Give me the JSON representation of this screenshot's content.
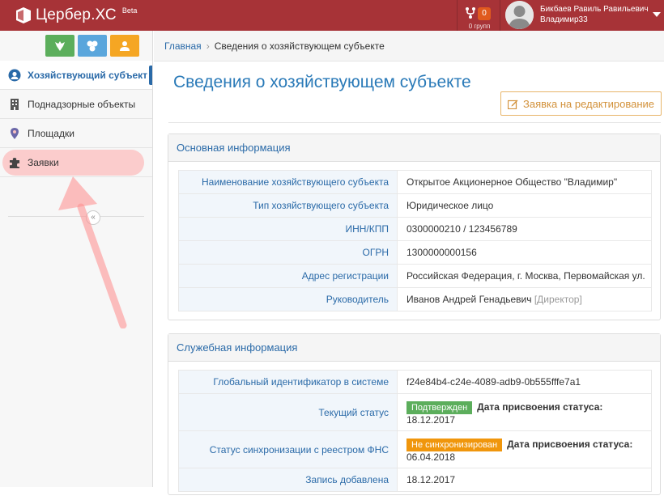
{
  "header": {
    "brand_name": "Цербер.ХС",
    "brand_badge": "Beta",
    "notifications_count": "0",
    "notifications_label": "0 групп",
    "user_name": "Бикбаев Равиль Равильевич",
    "user_sub": "Владимир33"
  },
  "sidebar": {
    "items": [
      {
        "label": "Хозяйствующий субъект",
        "icon": "user-circle-icon",
        "active": true
      },
      {
        "label": "Поднадзорные объекты",
        "icon": "building-icon",
        "active": false
      },
      {
        "label": "Площадки",
        "icon": "map-marker-icon",
        "active": false
      },
      {
        "label": "Заявки",
        "icon": "puzzle-icon",
        "active": false
      }
    ],
    "collapse_label": "«"
  },
  "breadcrumb": {
    "home": "Главная",
    "separator": "›",
    "current": "Сведения о хозяйствующем субъекте"
  },
  "page": {
    "title": "Сведения о хозяйствующем субъекте",
    "edit_button": "Заявка на редактирование"
  },
  "basic_info": {
    "heading": "Основная информация",
    "rows": [
      {
        "label": "Наименование хозяйствующего субъекта",
        "value": "Открытое Акционерное Общество \"Владимир\""
      },
      {
        "label": "Тип хозяйствующего субъекта",
        "value": "Юридическое лицо"
      },
      {
        "label": "ИНН/КПП",
        "value": "0300000210 / 123456789"
      },
      {
        "label": "ОГРН",
        "value": "1300000000156"
      },
      {
        "label": "Адрес регистрации",
        "value": "Российская Федерация, г. Москва, Первомайская ул."
      },
      {
        "label": "Руководитель",
        "value": "Иванов Андрей Генадьевич",
        "extra": "[Директор]"
      }
    ]
  },
  "service_info": {
    "heading": "Служебная информация",
    "rows": [
      {
        "label": "Глобальный идентификатор в системе",
        "value": "f24e84b4-c24e-4089-adb9-0b555fffe7a1"
      },
      {
        "label": "Текущий статус",
        "badge": "Подтвержден",
        "date_label": "Дата присвоения статуса:",
        "date": "18.12.2017"
      },
      {
        "label": "Статус синхронизации с реестром ФНС",
        "badge": "Не синхронизирован",
        "date_label": "Дата присвоения статуса:",
        "date": "06.04.2018"
      },
      {
        "label": "Запись добавлена",
        "value": "18.12.2017"
      }
    ]
  },
  "colors": {
    "header_bg": "#a73337",
    "accent_blue": "#2a6aa8",
    "success_green": "#5cae5c",
    "warning_orange": "#f0960c",
    "edit_button_orange": "#d2913a"
  }
}
